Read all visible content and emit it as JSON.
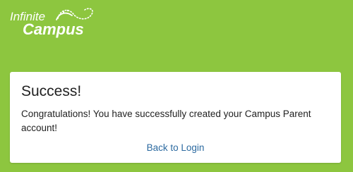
{
  "logo": {
    "line1": "Infinite",
    "line2": "Campus",
    "icon": "infinity-swirl-icon"
  },
  "card": {
    "title": "Success!",
    "message": "Congratulations! You have successfully created your Campus Parent account!",
    "back_link": "Back to Login"
  },
  "colors": {
    "background": "#8dc63f",
    "link": "#2c6aa0",
    "card": "#ffffff"
  }
}
